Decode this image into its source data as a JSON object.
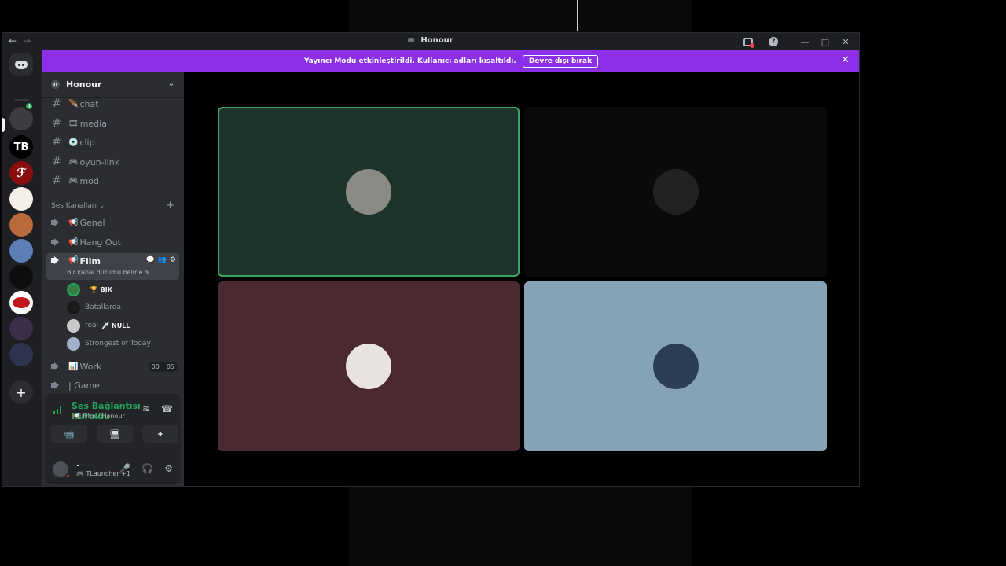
{
  "window": {
    "title": "Honour",
    "nav_back": "←",
    "nav_forward": "→",
    "help_label": "?",
    "minimize": "—",
    "maximize": "□",
    "close": "✕"
  },
  "banner": {
    "message": "Yayıncı Modu etkinleştirildi. Kullanıcı adları kısaltıldı.",
    "button": "Devre dışı bırak",
    "close": "✕"
  },
  "guild_bar": {
    "add_label": "+",
    "badge": "4",
    "server_labels": [
      "TB",
      "ℱ"
    ]
  },
  "server": {
    "zero_badge": "0",
    "name": "Honour",
    "chevron": "⌄",
    "text_channels": [
      {
        "emoji": "🪶",
        "name": "chat"
      },
      {
        "emoji": "🎞",
        "name": "media"
      },
      {
        "emoji": "💿",
        "name": "clip"
      },
      {
        "emoji": "🎮",
        "name": "oyun-link"
      },
      {
        "emoji": "🎮",
        "name": "mod"
      }
    ],
    "voice_category": "Ses Kanalları ⌄",
    "voice_category_add": "+",
    "voice_channels": [
      {
        "emoji": "📢",
        "name": "Genel"
      },
      {
        "emoji": "📢",
        "name": "Hang Out"
      },
      {
        "emoji": "📢",
        "name": "Film"
      },
      {
        "emoji": "📊",
        "name": "Work"
      },
      {
        "emoji": "",
        "name": "| Game"
      }
    ],
    "film_status_hint": "Bir kanal durumu belirle ✎",
    "film_icons": [
      "💬",
      "👥",
      "⚙"
    ],
    "voice_users": [
      {
        "name": ".",
        "tag": "🏆 BJK",
        "color": "#3a7d44"
      },
      {
        "name": "Batallarda",
        "tag": "",
        "color": "#1a1a1a"
      },
      {
        "name": "real",
        "tag": "🗡 NULL",
        "color": "#c9c9c9"
      },
      {
        "name": "Strongest of Today",
        "tag": "",
        "color": "#9fb3c8"
      }
    ],
    "work_count": [
      "00",
      "05"
    ]
  },
  "voice_panel": {
    "status": "Ses Bağlantısı Kuruldu",
    "path": "📢 Film / Honour",
    "buttons": [
      "📹",
      "🖥",
      "✦",
      "🎉"
    ],
    "noise_icon": "≋",
    "disconnect_icon": "☎",
    "user_name": ".",
    "user_activity": "🎮 TLauncher +1",
    "controls": [
      "🎤",
      "🎧",
      "⚙"
    ]
  },
  "tiles": [
    {
      "bg": "#1f332d",
      "speaking": true,
      "avatar": "#8a8b85"
    },
    {
      "bg": "#0a0a0a",
      "speaking": false,
      "avatar": "#222222"
    },
    {
      "bg": "#4a2a30",
      "speaking": false,
      "avatar": "#e9e3df"
    },
    {
      "bg": "#85a3b4",
      "speaking": false,
      "avatar": "#2c3e55"
    }
  ],
  "colors": {
    "accent_purple": "#8b2fe8",
    "connected_green": "#23a55a",
    "speaking_border": "#3ba55c"
  }
}
